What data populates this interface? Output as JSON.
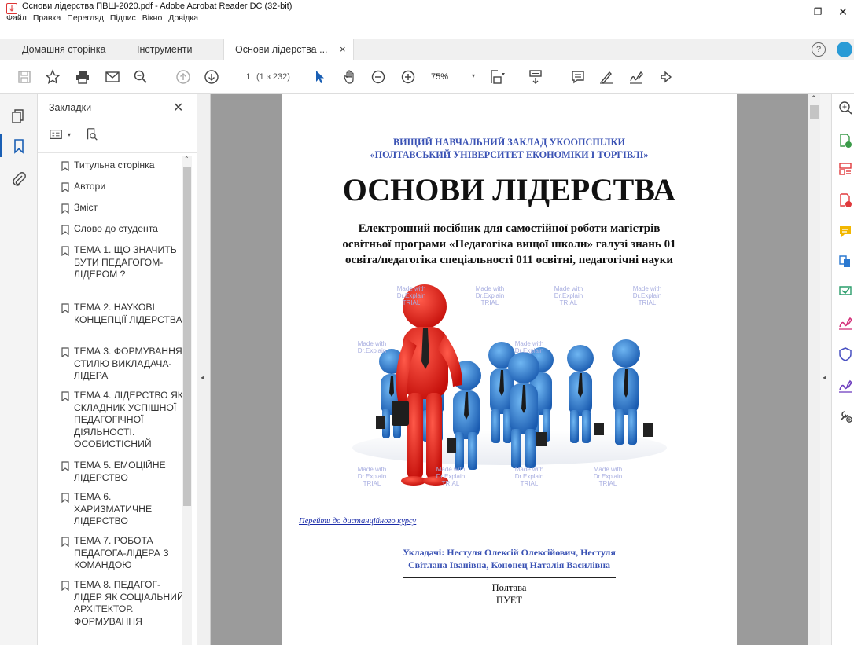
{
  "window": {
    "title": "Основи лідерства ПВШ-2020.pdf - Adobe Acrobat Reader DC (32-bit)",
    "menu": [
      "Файл",
      "Правка",
      "Перегляд",
      "Підпис",
      "Вікно",
      "Довідка"
    ],
    "controls": {
      "minimize": "–",
      "maximize": "❐",
      "close": "✕"
    }
  },
  "tabs": {
    "home": "Домашня сторінка",
    "tools": "Інструменти",
    "document": "Основи лідерства ...",
    "close": "×",
    "help": "?"
  },
  "toolbar": {
    "page_current": "1",
    "page_total": "(1 з 232)",
    "zoom": "75%"
  },
  "bookmarks": {
    "title": "Закладки",
    "close": "✕",
    "items": [
      "Титульна сторінка",
      "Автори",
      "Зміст",
      "Слово до студента",
      "ТЕМА 1. ЩО ЗНАЧИТЬ БУТИ ПЕДАГОГОМ-ЛІДЕРОМ ?",
      "ТЕМА 2. НАУКОВІ КОНЦЕПЦІЇ ЛІДЕРСТВА",
      "ТЕМА 3. ФОРМУВАННЯ СТИЛЮ ВИКЛАДАЧА-ЛІДЕРА",
      "ТЕМА 4. ЛІДЕРСТВО ЯК СКЛАДНИК УСПІШНОЇ ПЕДАГОГІЧНОЇ ДІЯЛЬНОСТІ. ОСОБИСТІСНИЙ",
      "ТЕМА 5. ЕМОЦІЙНЕ ЛІДЕРСТВО",
      "ТЕМА 6. ХАРИЗМАТИЧНЕ ЛІДЕРСТВО",
      "ТЕМА 7.  РОБОТА ПЕДАГОГА-ЛІДЕРА З КОМАНДОЮ",
      "ТЕМА 8. ПЕДАГОГ-ЛІДЕР ЯК СОЦІАЛЬНИЙ АРХІТЕКТОР. ФОРМУВАННЯ"
    ]
  },
  "document": {
    "institution_line1": "ВИЩИЙ НАВЧАЛЬНИЙ ЗАКЛАД УКООПСПІЛКИ",
    "institution_line2": "«ПОЛТАВСЬКИЙ УНІВЕРСИТЕТ ЕКОНОМІКИ І ТОРГІВЛІ»",
    "title": "ОСНОВИ ЛІДЕРСТВА",
    "subtitle_line1": "Електронний посібник для самостійної роботи магістрів",
    "subtitle_line2": "освітньої програми «Педагогіка вищої школи» галузі знань 01",
    "subtitle_line3": "освіта/педагогіка спеціальності 011 освітні, педагогічні науки",
    "link": "Перейти до дистанційного курсу",
    "authors_line1": "Укладачі: Нестуля Олексій Олексійович, Нестуля",
    "authors_line2": "Світлана Іванівна, Кононец Наталія Василівна",
    "city": "Полтава",
    "publisher": "ПУЕТ",
    "watermark": [
      "Made with",
      "Dr.Explain",
      "TRIAL"
    ]
  },
  "colors": {
    "accent_blue": "#3a52b4",
    "app_red": "#d32f2f",
    "doc_gray": "#9b9b9b",
    "figure_red": "#e0201a",
    "figure_blue": "#2a78d0"
  }
}
